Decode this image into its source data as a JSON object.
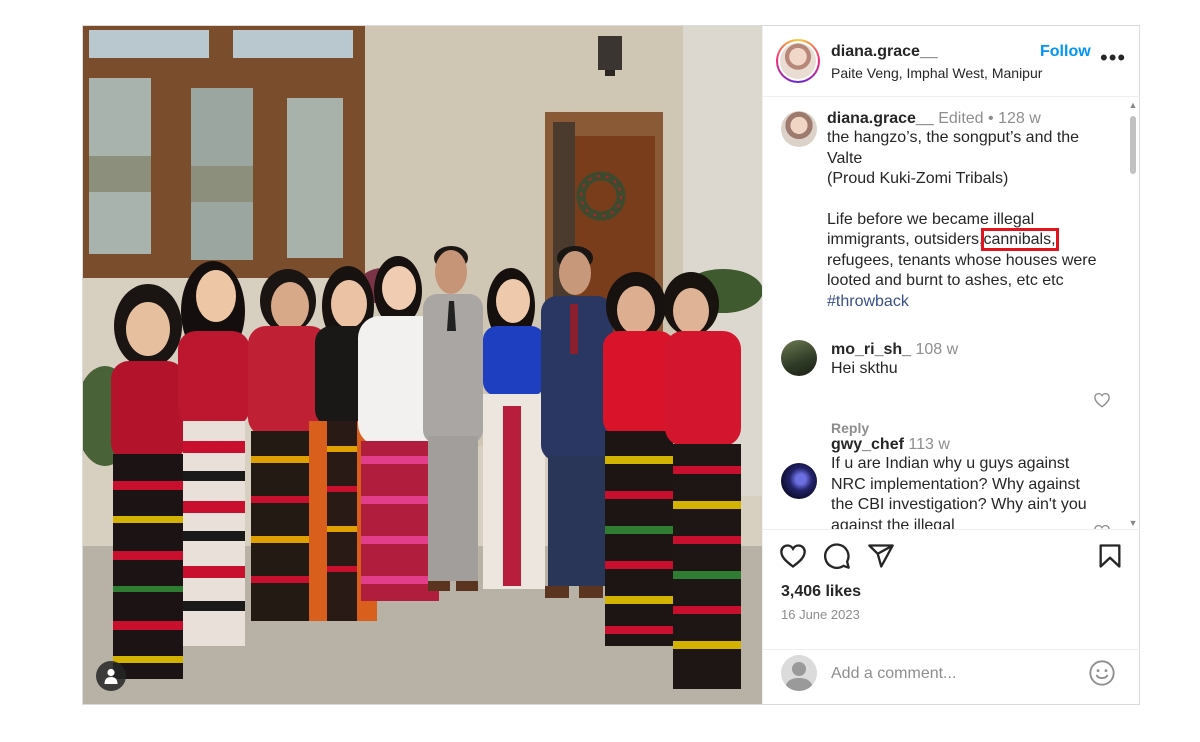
{
  "post": {
    "username": "diana.grace__",
    "location": "Paite Veng, Imphal West, Manipur",
    "follow_label": "Follow",
    "more_label": "•••"
  },
  "caption": {
    "username": "diana.grace__",
    "edited": "Edited",
    "separator": "•",
    "time": "128 w",
    "line1": "the hangzo’s, the songput’s and the Valte",
    "line2": "(Proud Kuki-Zomi Tribals)",
    "line3_pre": "Life before we became illegal immigrants, outsiders,",
    "line3_highlight": "cannibals,",
    "line3_post": "refugees, tenants whose houses were looted and burnt to ashes, etc etc",
    "hashtag": "#throwback"
  },
  "comments": [
    {
      "username": "mo_ri_sh_",
      "time": "108 w",
      "text": "Hei skthu",
      "reply_label": "Reply"
    },
    {
      "username": "gwy_chef",
      "time": "113 w",
      "text": "If u are Indian why u guys against NRC implementation? Why against the CBI investigation? Why ain't you against the illegal"
    }
  ],
  "stats": {
    "likes": "3,406 likes",
    "date": "16 June 2023"
  },
  "add_comment": {
    "placeholder": "Add a comment..."
  },
  "icons": [
    "heart-icon",
    "comment-icon",
    "share-icon",
    "bookmark-icon",
    "emoji-icon",
    "user-tag-icon",
    "more-icon"
  ],
  "colors": {
    "follow": "#0095f6",
    "highlight_box": "#e0151d",
    "hashtag": "#385185",
    "muted": "#8e8e8e"
  }
}
